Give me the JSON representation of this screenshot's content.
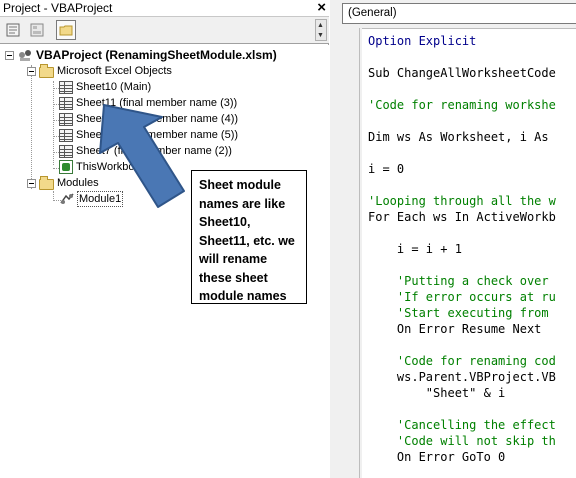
{
  "project_explorer": {
    "title": "Project - VBAProject",
    "close_glyph": "×",
    "toolbar": [
      "view-code-icon",
      "view-object-icon",
      "toggle-folders-icon"
    ],
    "tree": {
      "project_label": "VBAProject (RenamingSheetModule.xlsm)",
      "excel_objects_folder": "Microsoft Excel Objects",
      "sheets": [
        "Sheet10 (Main)",
        "Sheet11 (final member name (3))",
        "Sheet12 (final member name (4))",
        "Sheet13 (final member name (5))",
        "Sheet7 (final member name (2))"
      ],
      "workbook_item": "ThisWorkbook",
      "modules_folder": "Modules",
      "module_item": "Module1"
    }
  },
  "annotation": {
    "callout_text": "Sheet module names are like Sheet10, Sheet11, etc. we will rename these sheet module names",
    "arrow_color": "#4a77b4"
  },
  "code_window": {
    "object_dropdown": "(General)",
    "lines": [
      {
        "kind": "kw",
        "text": "Option Explicit"
      },
      {
        "kind": "tx",
        "text": ""
      },
      {
        "kind": "tx",
        "text": "Sub ChangeAllWorksheetCode"
      },
      {
        "kind": "tx",
        "text": ""
      },
      {
        "kind": "cm",
        "text": "'Code for renaming workshe"
      },
      {
        "kind": "tx",
        "text": ""
      },
      {
        "kind": "tx",
        "text": "Dim ws As Worksheet, i As"
      },
      {
        "kind": "tx",
        "text": ""
      },
      {
        "kind": "tx",
        "text": "i = 0"
      },
      {
        "kind": "tx",
        "text": ""
      },
      {
        "kind": "cm",
        "text": "'Looping through all the w"
      },
      {
        "kind": "tx",
        "text": "For Each ws In ActiveWorkb"
      },
      {
        "kind": "tx",
        "text": ""
      },
      {
        "kind": "tx",
        "text": "    i = i + 1"
      },
      {
        "kind": "tx",
        "text": ""
      },
      {
        "kind": "cm",
        "text": "    'Putting a check over"
      },
      {
        "kind": "cm",
        "text": "    'If error occurs at ru"
      },
      {
        "kind": "cm",
        "text": "    'Start executing from"
      },
      {
        "kind": "tx",
        "text": "    On Error Resume Next"
      },
      {
        "kind": "tx",
        "text": ""
      },
      {
        "kind": "cm",
        "text": "    'Code for renaming cod"
      },
      {
        "kind": "tx",
        "text": "    ws.Parent.VBProject.VB"
      },
      {
        "kind": "tx",
        "text": "        \"Sheet\" & i"
      },
      {
        "kind": "tx",
        "text": ""
      },
      {
        "kind": "cm",
        "text": "    'Cancelling the effect"
      },
      {
        "kind": "cm",
        "text": "    'Code will not skip th"
      },
      {
        "kind": "tx",
        "text": "    On Error GoTo 0"
      }
    ]
  },
  "colors": {
    "keyword": "#00008b",
    "comment": "#008000",
    "folder": "#f2d98a"
  }
}
